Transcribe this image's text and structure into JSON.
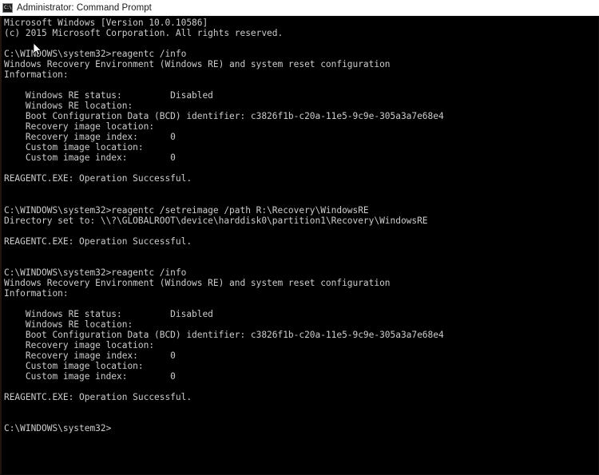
{
  "window": {
    "title": "Administrator: Command Prompt",
    "icon": "command-prompt-icon",
    "icon_glyph": "C:\\",
    "titlebar_bg": "#ffffff",
    "titlebar_fg": "#1b1b1b",
    "console_bg": "#000000",
    "console_fg": "#cccccc"
  },
  "console": {
    "lines": [
      "Microsoft Windows [Version 10.0.10586]",
      "(c) 2015 Microsoft Corporation. All rights reserved.",
      "",
      "C:\\WINDOWS\\system32>reagentc /info",
      "Windows Recovery Environment (Windows RE) and system reset configuration",
      "Information:",
      "",
      "    Windows RE status:         Disabled",
      "    Windows RE location:",
      "    Boot Configuration Data (BCD) identifier: c3826f1b-c20a-11e5-9c9e-305a3a7e68e4",
      "    Recovery image location:",
      "    Recovery image index:      0",
      "    Custom image location:",
      "    Custom image index:        0",
      "",
      "REAGENTC.EXE: Operation Successful.",
      "",
      "",
      "C:\\WINDOWS\\system32>reagentc /setreimage /path R:\\Recovery\\WindowsRE",
      "Directory set to: \\\\?\\GLOBALROOT\\device\\harddisk0\\partition1\\Recovery\\WindowsRE",
      "",
      "REAGENTC.EXE: Operation Successful.",
      "",
      "",
      "C:\\WINDOWS\\system32>reagentc /info",
      "Windows Recovery Environment (Windows RE) and system reset configuration",
      "Information:",
      "",
      "    Windows RE status:         Disabled",
      "    Windows RE location:",
      "    Boot Configuration Data (BCD) identifier: c3826f1b-c20a-11e5-9c9e-305a3a7e68e4",
      "    Recovery image location:",
      "    Recovery image index:      0",
      "    Custom image location:",
      "    Custom image index:        0",
      "",
      "REAGENTC.EXE: Operation Successful.",
      "",
      "",
      "C:\\WINDOWS\\system32>"
    ],
    "prompt": "C:\\WINDOWS\\system32>",
    "commands": [
      "reagentc /info",
      "reagentc /setreimage /path R:\\Recovery\\WindowsRE",
      "reagentc /info"
    ],
    "fields": {
      "windows_re_status": "Disabled",
      "windows_re_location": "",
      "bcd_identifier": "c3826f1b-c20a-11e5-9c9e-305a3a7e68e4",
      "recovery_image_location": "",
      "recovery_image_index": "0",
      "custom_image_location": "",
      "custom_image_index": "0",
      "directory_set_to": "\\\\?\\GLOBALROOT\\device\\harddisk0\\partition1\\Recovery\\WindowsRE",
      "result": "REAGENTC.EXE: Operation Successful."
    }
  },
  "cursor": {
    "name": "mouse-arrow-pointer",
    "x": "42",
    "y": "54"
  }
}
